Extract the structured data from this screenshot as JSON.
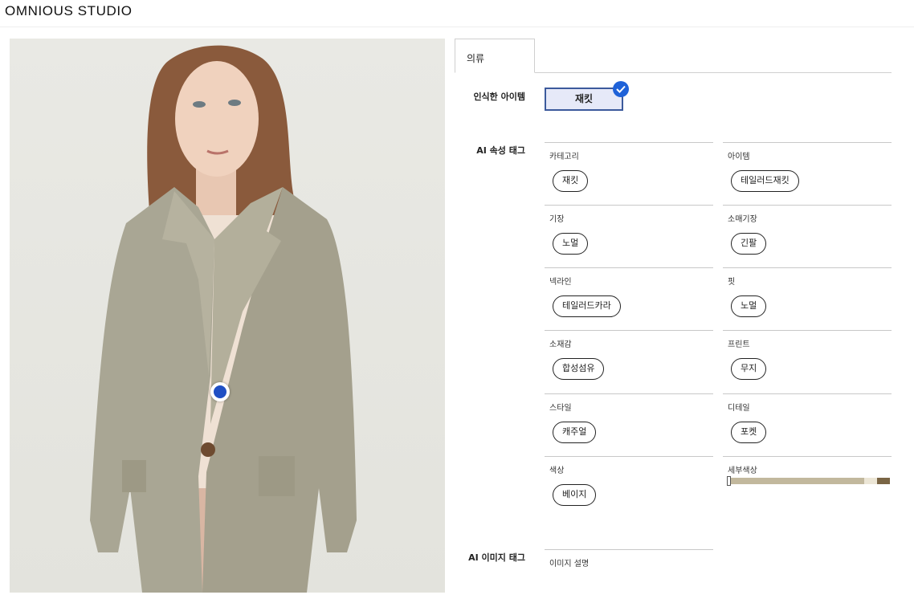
{
  "header": {
    "logo": "OMNIOUS STUDIO"
  },
  "tabs": [
    {
      "label": "의류"
    }
  ],
  "recognized": {
    "label": "인식한 아이템",
    "item": "재킷"
  },
  "attributes": {
    "label": "AI 속성 태그",
    "cells": [
      {
        "label": "카테고리",
        "tag": "재킷"
      },
      {
        "label": "아이템",
        "tag": "테일러드재킷"
      },
      {
        "label": "기장",
        "tag": "노멀"
      },
      {
        "label": "소매기장",
        "tag": "긴팔"
      },
      {
        "label": "넥라인",
        "tag": "테일러드카라"
      },
      {
        "label": "핏",
        "tag": "노멀"
      },
      {
        "label": "소재감",
        "tag": "합성섬유"
      },
      {
        "label": "프린트",
        "tag": "무지"
      },
      {
        "label": "스타일",
        "tag": "캐주얼"
      },
      {
        "label": "디테일",
        "tag": "포켓"
      },
      {
        "label": "색상",
        "tag": "베이지"
      },
      {
        "label": "세부색상"
      }
    ],
    "detail_colors": [
      {
        "color": "#c2b89d",
        "share": 0.84
      },
      {
        "color": "#ece6d6",
        "share": 0.08
      },
      {
        "color": "#7a6545",
        "share": 0.08
      }
    ]
  },
  "image_tags": {
    "label": "AI 이미지 태그",
    "description_label": "이미지 설명"
  },
  "colors": {
    "accent": "#1f4fc4",
    "chip_bg": "#e6e9f8",
    "chip_border": "#3c5a9c"
  }
}
